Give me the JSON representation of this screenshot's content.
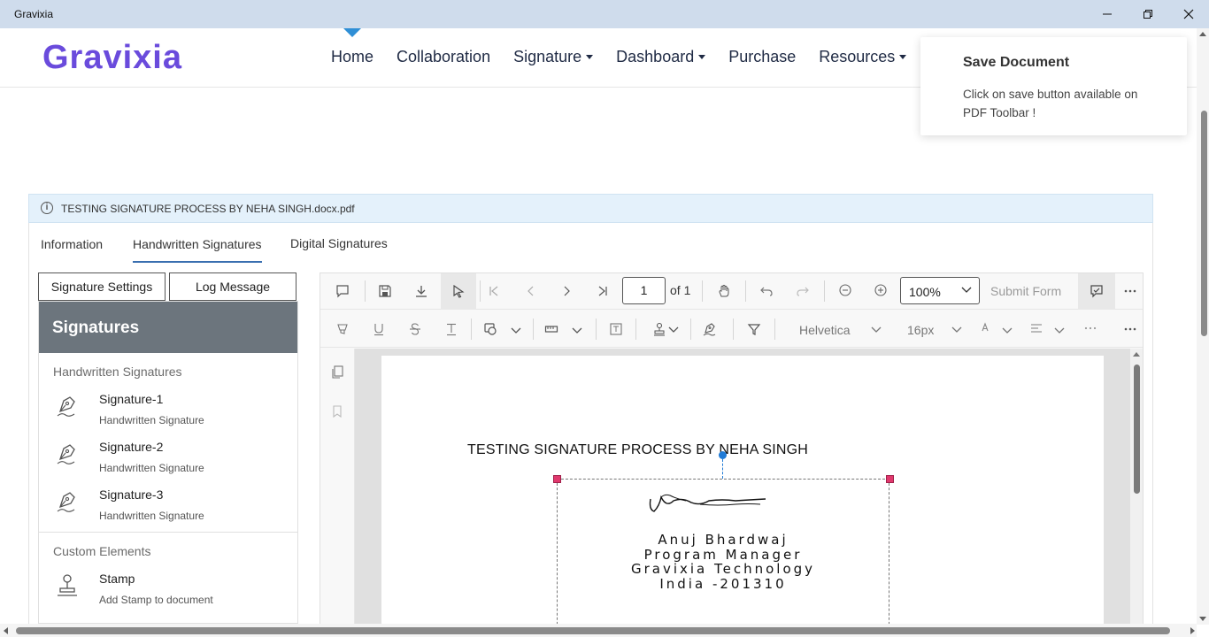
{
  "window": {
    "title": "Gravixia"
  },
  "header": {
    "logo": "Gravixia",
    "nav": [
      {
        "label": "Home",
        "dropdown": false
      },
      {
        "label": "Collaboration",
        "dropdown": false
      },
      {
        "label": "Signature",
        "dropdown": true
      },
      {
        "label": "Dashboard",
        "dropdown": true
      },
      {
        "label": "Purchase",
        "dropdown": false
      },
      {
        "label": "Resources",
        "dropdown": true
      }
    ]
  },
  "toast": {
    "title": "Save Document",
    "body": "Click on save button available on PDF Toolbar !"
  },
  "file": {
    "name": "TESTING SIGNATURE PROCESS BY NEHA SINGH.docx.pdf"
  },
  "tabs": [
    {
      "label": "Information",
      "active": false
    },
    {
      "label": "Handwritten Signatures",
      "active": true
    },
    {
      "label": "Digital Signatures",
      "active": false
    }
  ],
  "left_panel": {
    "settings_button": "Signature Settings",
    "log_button": "Log Message",
    "header": "Signatures",
    "handwritten_title": "Handwritten Signatures",
    "signatures": [
      {
        "name": "Signature-1",
        "type": "Handwritten Signature"
      },
      {
        "name": "Signature-2",
        "type": "Handwritten Signature"
      },
      {
        "name": "Signature-3",
        "type": "Handwritten Signature"
      }
    ],
    "custom_title": "Custom Elements",
    "custom": [
      {
        "name": "Stamp",
        "desc": "Add Stamp to document"
      }
    ]
  },
  "viewer": {
    "page_current": "1",
    "page_total_text": "of 1",
    "zoom": "100%",
    "submit_form": "Submit Form",
    "font_name": "Helvetica",
    "font_size": "16px",
    "document": {
      "title": "TESTING SIGNATURE PROCESS BY NEHA SINGH",
      "signature_lines": [
        "Anuj Bhardwaj",
        "Program Manager",
        "Gravixia Technology",
        "India -201310"
      ]
    }
  },
  "colors": {
    "titlebar": "#cfdcec",
    "logo": "#6a4bdc",
    "accent": "#2f8fd6",
    "signatures_header": "#6c757d",
    "selection_handle": "#e0386d"
  }
}
